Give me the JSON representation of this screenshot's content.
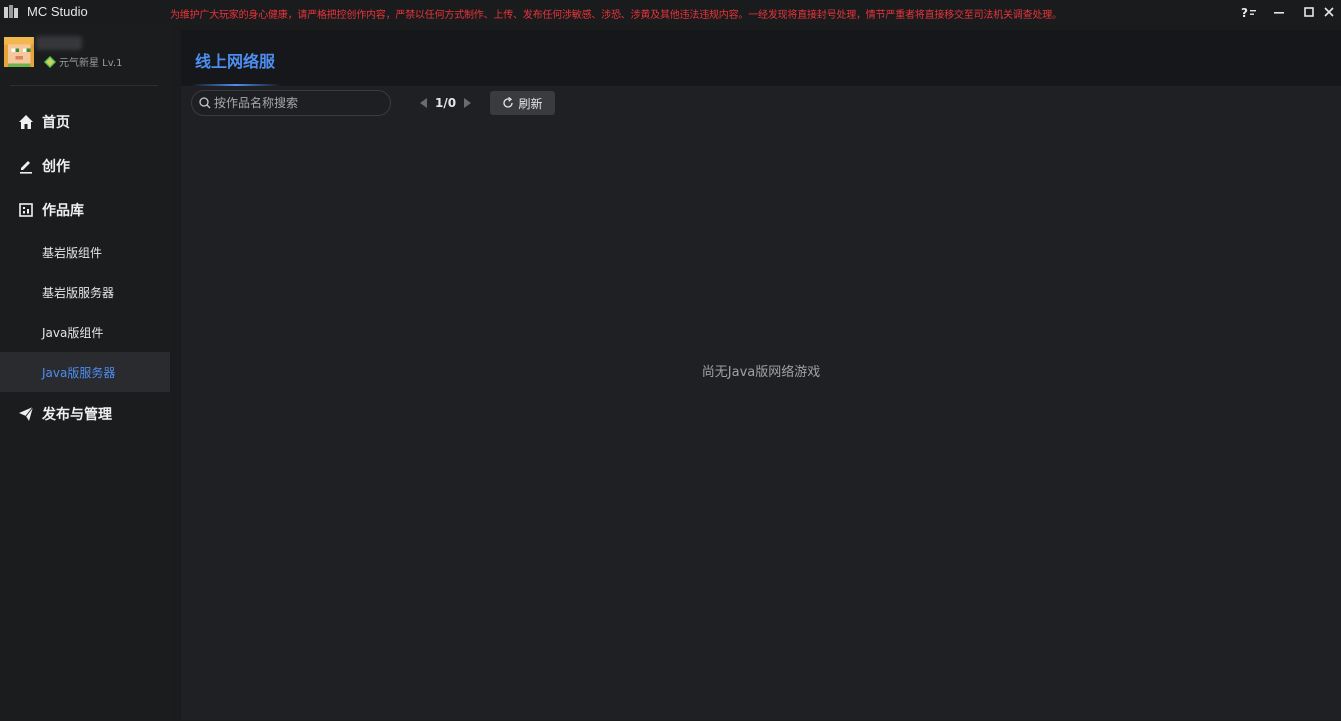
{
  "window": {
    "title": "MC Studio",
    "notice": "为维护广大玩家的身心健康，请严格把控创作内容，严禁以任何方式制作、上传、发布任何涉敏感、涉恐、涉黄及其他违法违规内容。一经发现将直接封号处理，情节严重者将直接移交至司法机关调查处理。",
    "controls": [
      "help-icon",
      "minimize-icon",
      "maximize-icon",
      "close-icon"
    ]
  },
  "profile": {
    "level": "元气新星 Lv.1"
  },
  "nav": {
    "home": "首页",
    "create": "创作",
    "library": "作品库",
    "library_items": [
      {
        "label": "基岩版组件",
        "active": false
      },
      {
        "label": "基岩版服务器",
        "active": false
      },
      {
        "label": "Java版组件",
        "active": false
      },
      {
        "label": "Java版服务器",
        "active": true
      }
    ],
    "publish": "发布与管理"
  },
  "main": {
    "title": "线上网络服",
    "search_placeholder": "按作品名称搜索",
    "page_text": "1/0",
    "refresh_label": "刷新",
    "empty_text": "尚无Java版网络游戏"
  },
  "colors": {
    "accent": "#4d8ef0",
    "notice": "#e8343a",
    "background": "#1f2023"
  }
}
